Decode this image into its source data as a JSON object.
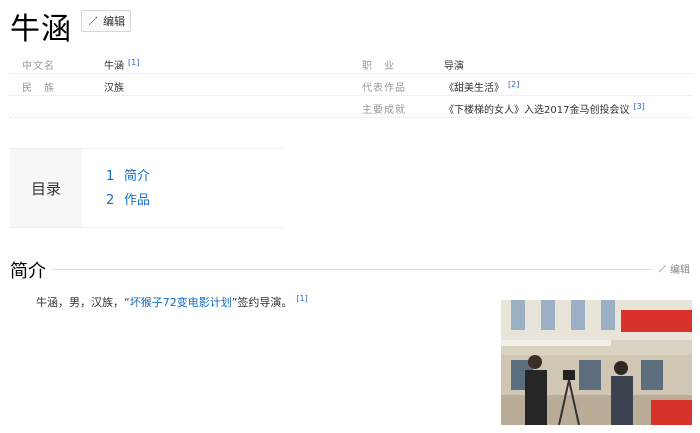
{
  "page": {
    "title": "牛涵",
    "edit_label": "编辑"
  },
  "infobox": {
    "rows": [
      {
        "left_label": "中文名",
        "left_value": "牛涵",
        "left_ref": "[1]",
        "right_label": "职　业",
        "right_value": "导演",
        "right_ref": ""
      },
      {
        "left_label": "民　族",
        "left_value": "汉族",
        "left_ref": "",
        "right_label": "代表作品",
        "right_value": "《甜美生活》",
        "right_ref": "[2]"
      },
      {
        "left_label": "",
        "left_value": "",
        "left_ref": "",
        "right_label": "主要成就",
        "right_value": "《下楼梯的女人》入选2017金马创投会议",
        "right_ref": "[3]"
      }
    ]
  },
  "toc": {
    "heading": "目录",
    "items": [
      {
        "num": "1",
        "label": "简介"
      },
      {
        "num": "2",
        "label": "作品"
      }
    ]
  },
  "section": {
    "title": "简介",
    "edit_label": "编辑",
    "text_before": "牛涵，男，汉族，“",
    "link_text": "坏猴子72变电影计划",
    "text_after": "”签约导演。",
    "ref": "[1]"
  },
  "icons": {
    "edit": "pencil-icon"
  },
  "colors": {
    "link": "#136ec2",
    "accent": "#3366cc"
  }
}
